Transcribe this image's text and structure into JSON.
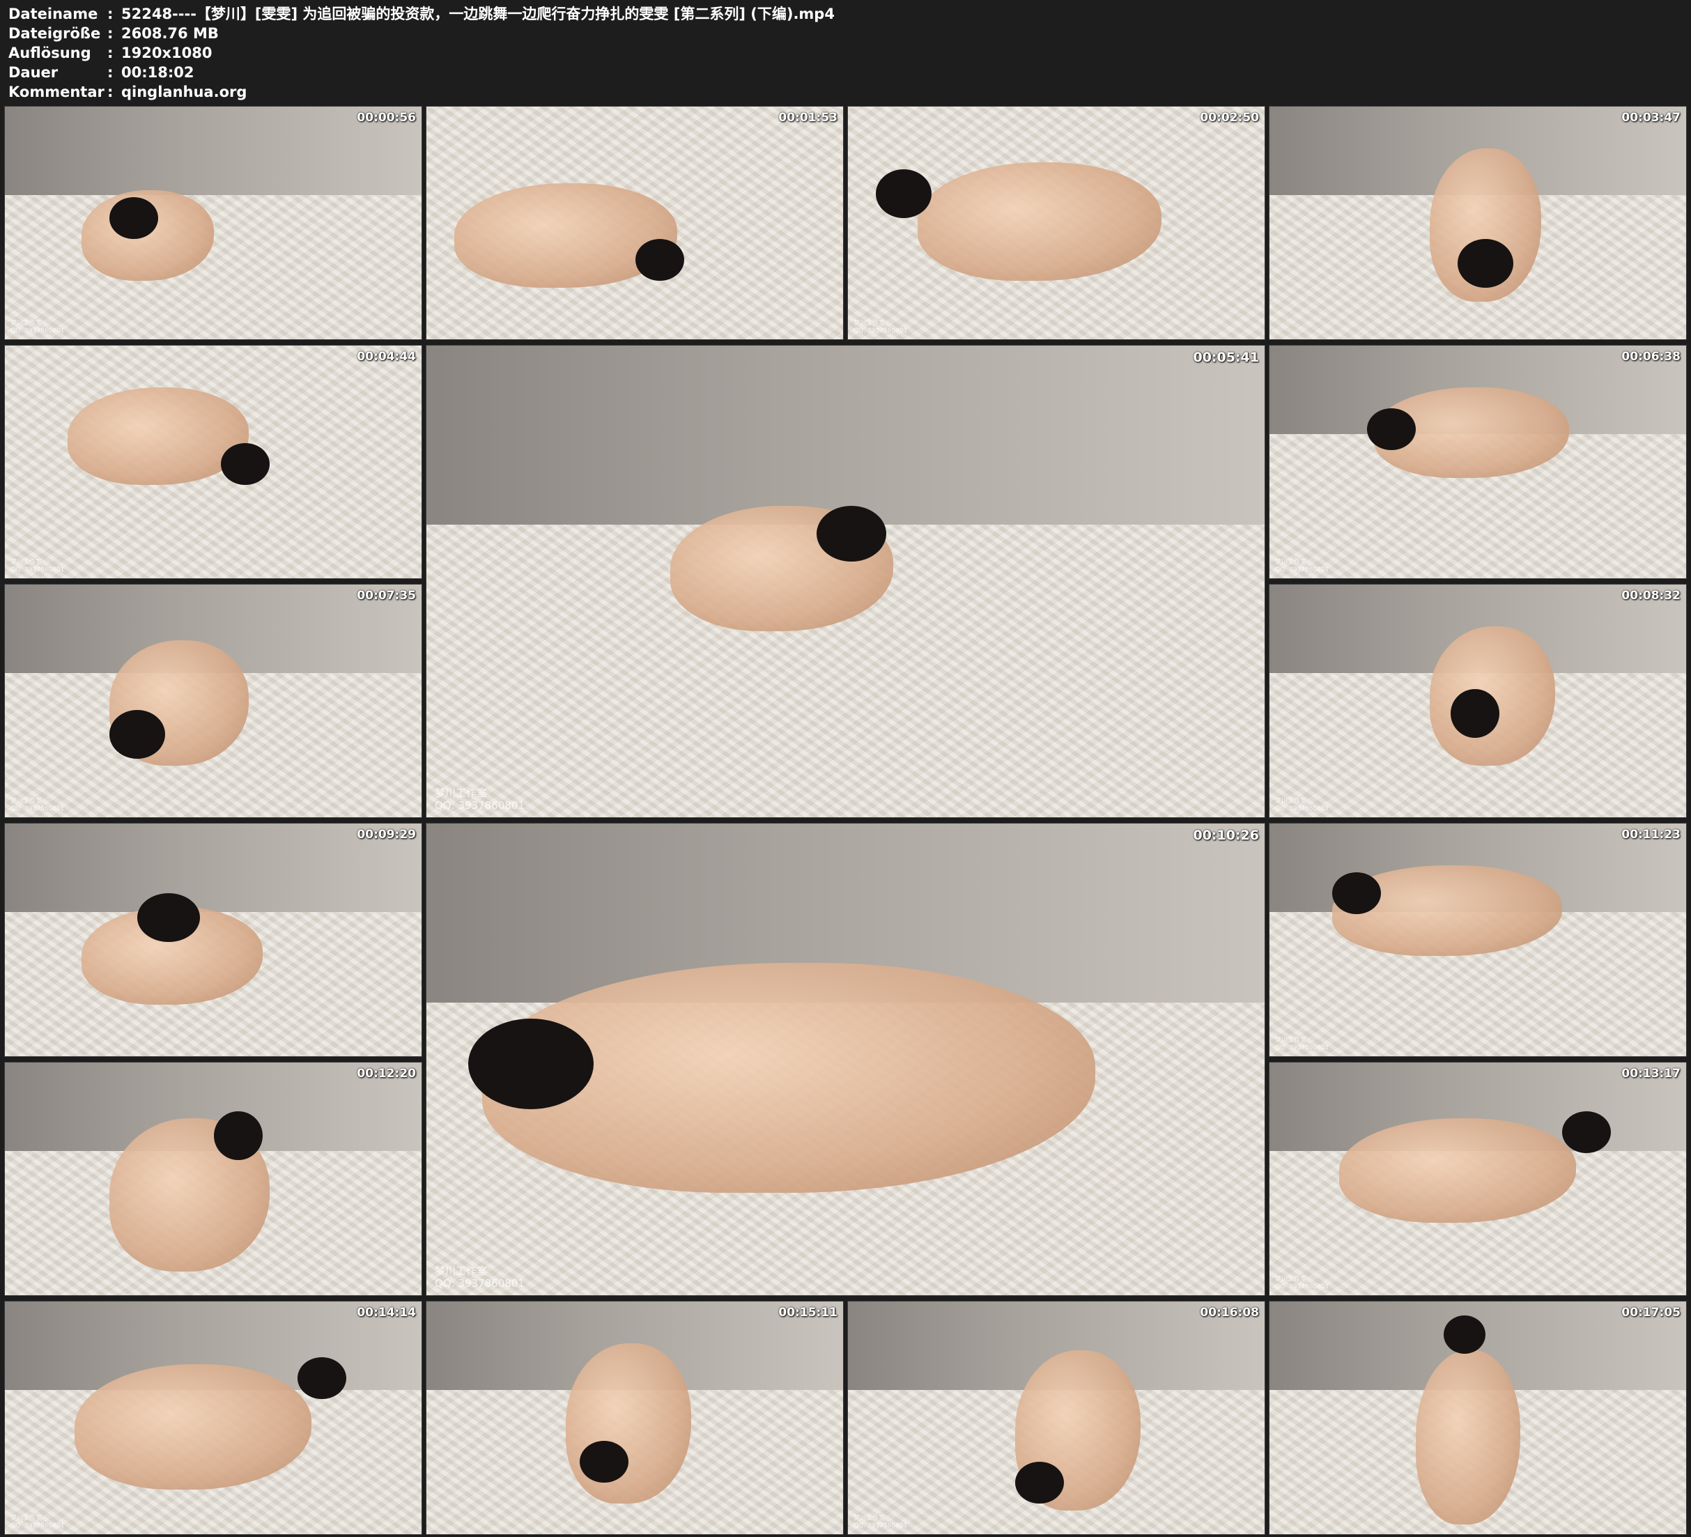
{
  "info": {
    "rows": [
      {
        "key": "Dateiname",
        "sep": ":",
        "value": "52248----【梦川】[雯雯] 为追回被骗的投资款，一边跳舞一边爬行奋力挣扎的雯雯 [第二系列] (下编).mp4"
      },
      {
        "key": "Dateigröße",
        "sep": ":",
        "value": "2608.76 MB"
      },
      {
        "key": "Auflösung",
        "sep": ":",
        "value": "1920x1080"
      },
      {
        "key": "Dauer",
        "sep": ":",
        "value": "00:18:02"
      },
      {
        "key": "Kommentar",
        "sep": ":",
        "value": "qinglanhua.org"
      }
    ]
  },
  "thumbnails": [
    {
      "time": "00:00:56",
      "wm1": "梦川工作室",
      "wm2": "QQ: 3937860801"
    },
    {
      "time": "00:01:53",
      "wm1": "",
      "wm2": ""
    },
    {
      "time": "00:02:50",
      "wm1": "梦川工作室",
      "wm2": "QQ: 3937860801"
    },
    {
      "time": "00:03:47",
      "wm1": "",
      "wm2": ""
    },
    {
      "time": "00:04:44",
      "wm1": "梦川工作室",
      "wm2": "QQ: 3937860801"
    },
    {
      "time": "00:05:41",
      "wm1": "梦川工作室",
      "wm2": "QQ: 3937860801"
    },
    {
      "time": "00:06:38",
      "wm1": "梦川工作室",
      "wm2": "QQ: 3937860801"
    },
    {
      "time": "00:07:35",
      "wm1": "梦川工作室",
      "wm2": "QQ: 3937860801"
    },
    {
      "time": "00:08:32",
      "wm1": "梦川工作室",
      "wm2": "QQ: 3937860801"
    },
    {
      "time": "00:09:29",
      "wm1": "",
      "wm2": ""
    },
    {
      "time": "00:10:26",
      "wm1": "梦川工作室",
      "wm2": "QQ: 3937860801"
    },
    {
      "time": "00:11:23",
      "wm1": "梦川工作室",
      "wm2": "QQ: 3937860801"
    },
    {
      "time": "00:12:20",
      "wm1": "",
      "wm2": ""
    },
    {
      "time": "00:13:17",
      "wm1": "梦川工作室",
      "wm2": "QQ: 3937860801"
    },
    {
      "time": "00:14:14",
      "wm1": "梦川工作室",
      "wm2": "QQ: 3937860801"
    },
    {
      "time": "00:15:11",
      "wm1": "",
      "wm2": ""
    },
    {
      "time": "00:16:08",
      "wm1": "梦川工作室",
      "wm2": "QQ: 3937860801"
    },
    {
      "time": "00:17:05",
      "wm1": "",
      "wm2": ""
    }
  ]
}
